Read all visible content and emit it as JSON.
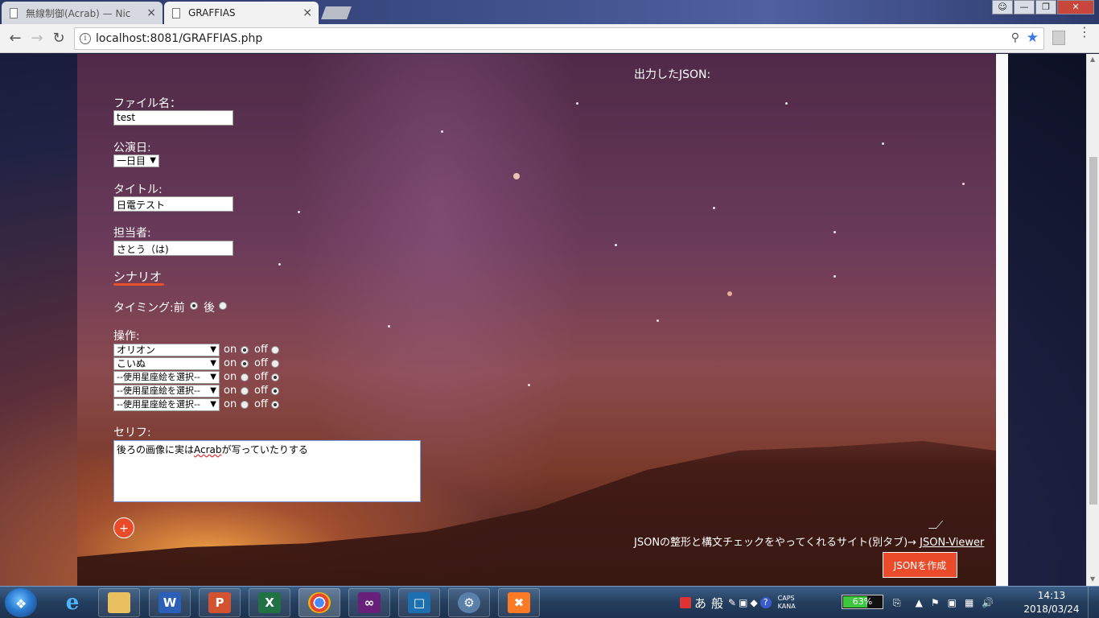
{
  "browser": {
    "tabs": [
      {
        "title": "無線制御(Acrab) — Nic",
        "active": false
      },
      {
        "title": "GRAFFIAS",
        "active": true
      }
    ],
    "url_host": "localhost",
    "url_port_path": ":8081/GRAFFIAS.php",
    "close_glyph": "×"
  },
  "form": {
    "filename_label": "ファイル名：",
    "filename_value": "test",
    "date_label": "公演日:",
    "date_value": "一日目",
    "title_label": "タイトル:",
    "title_value": "日電テスト",
    "person_label": "担当者:",
    "person_value": "さとう（は)",
    "scenario_heading": "シナリオ",
    "timing_label": "タイミング:前",
    "timing_after": "後",
    "timing_selected": "前",
    "operation_label": "操作:",
    "operations": [
      {
        "select": "オリオン",
        "on": "on",
        "off": "off",
        "state": "on"
      },
      {
        "select": "こいぬ",
        "on": "on",
        "off": "off",
        "state": "on"
      },
      {
        "select": "--使用星座絵を選択--",
        "on": "on",
        "off": "off",
        "state": "off"
      },
      {
        "select": "--使用星座絵を選択--",
        "on": "on",
        "off": "off",
        "state": "off"
      },
      {
        "select": "--使用星座絵を選択--",
        "on": "on",
        "off": "off",
        "state": "off"
      }
    ],
    "line_label": "セリフ:",
    "line_before": "後ろの画像に実は",
    "line_acrab": "Acrab",
    "line_after": "が写っていたりする",
    "add_button": "+"
  },
  "output": {
    "json_label": "出力したJSON:",
    "helper_text": "JSONの整形と構文チェックをやってくれるサイト(別タブ)→ ",
    "helper_link": "JSON-Viewer",
    "create_button": "JSONを作成"
  },
  "taskbar": {
    "ime_a": "あ",
    "ime_mode": "般",
    "caps": "CAPS",
    "kana": "KANA",
    "battery_percent": 63,
    "battery_label": "63%",
    "time": "14:13",
    "date": "2018/03/24",
    "help_glyph": "?"
  },
  "colors": {
    "accent": "#ea4b2a",
    "star_blue": "#3b78e7"
  },
  "icons": [
    "back-arrow-icon",
    "forward-arrow-icon",
    "reload-icon",
    "info-icon",
    "zoom-icon",
    "star-icon",
    "pdf-extension-icon",
    "menu-icon"
  ]
}
